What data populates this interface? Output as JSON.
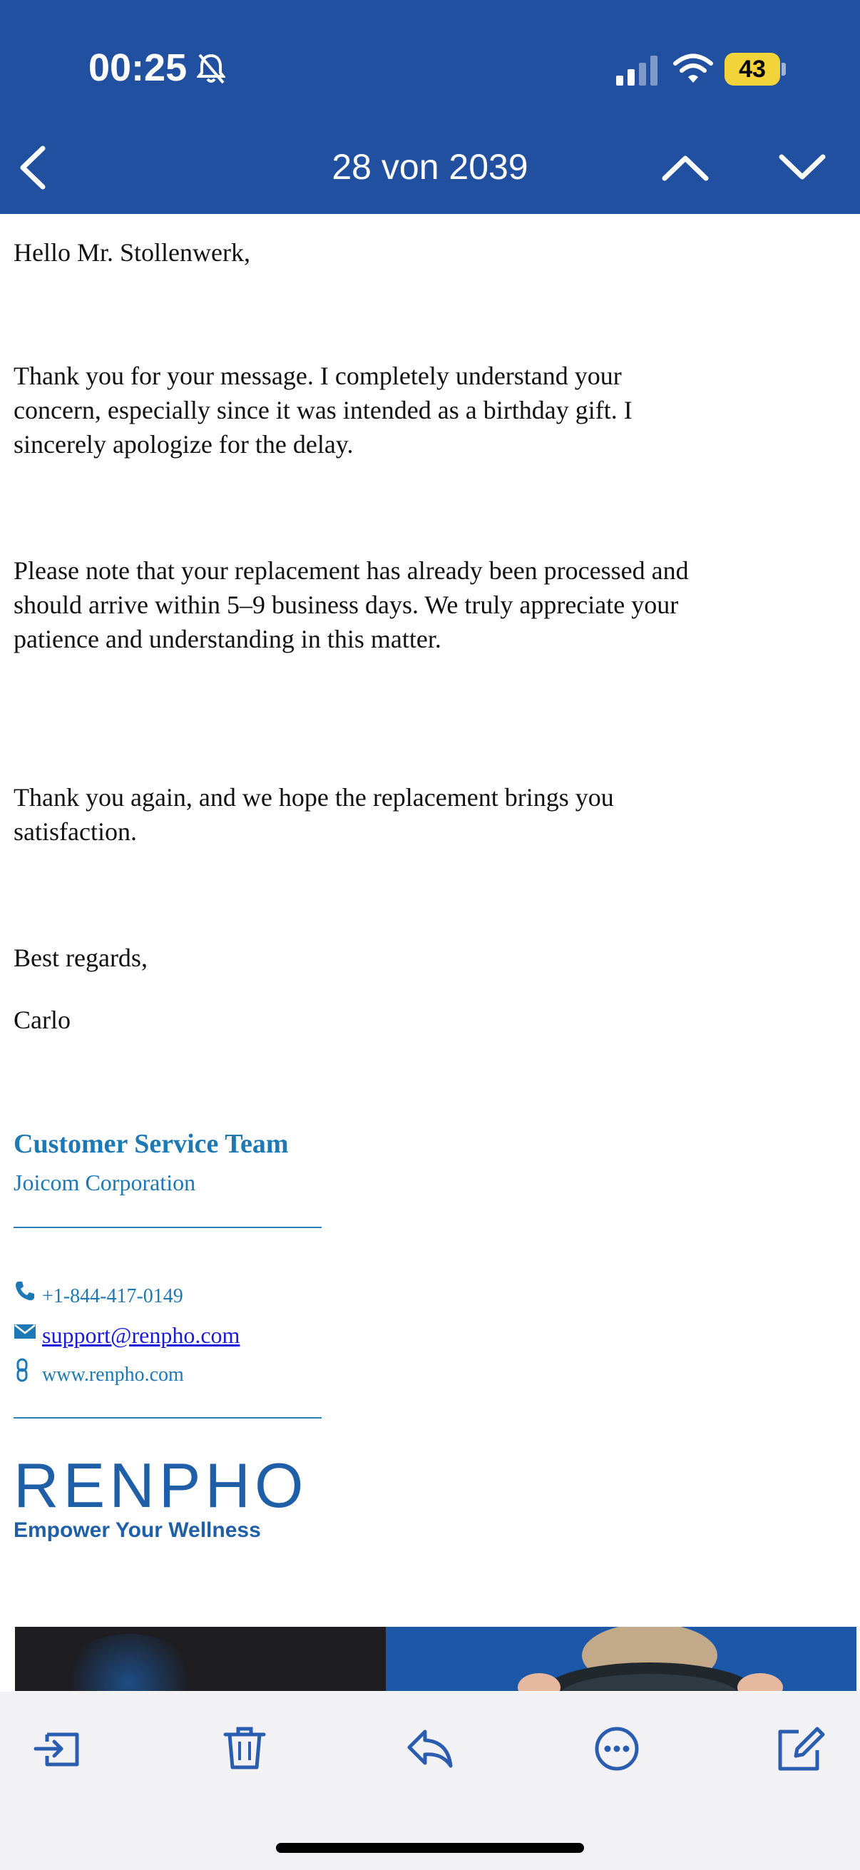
{
  "status_bar": {
    "time": "00:25",
    "battery": "43",
    "icons": [
      "bell-slash-icon",
      "cellular-signal-icon",
      "wifi-icon",
      "battery-icon"
    ]
  },
  "nav": {
    "counter": "28 von 2039",
    "icons": [
      "chevron-left-icon",
      "chevron-up-icon",
      "chevron-down-icon"
    ]
  },
  "email": {
    "greeting": "Hello Mr. Stollenwerk,",
    "paragraph1": "Thank you for your message. I completely understand your concern, especially since it was intended as a birthday gift. I sincerely apologize for the delay.",
    "paragraph2": "Please note that your replacement has already been processed and should arrive within 5–9 business days. We truly appreciate your patience and understanding in this matter.",
    "paragraph3": "Thank you again, and we hope the replacement brings you satisfaction.",
    "closing": "Best regards,",
    "name": "Carlo"
  },
  "signature": {
    "team": "Customer Service Team",
    "company": "Joicom Corporation",
    "phone": "+1-844-417-0149",
    "email": "support@renpho.com",
    "website": "www.renpho.com"
  },
  "logo": {
    "wordmark": "RENPHO",
    "tagline": "Empower Your Wellness"
  },
  "toolbar": {
    "icons": [
      "move-to-folder-icon",
      "trash-icon",
      "reply-icon",
      "more-icon",
      "compose-icon"
    ]
  },
  "colors": {
    "header": "#2150a0",
    "accent": "#1d78b6",
    "toolbar_icon": "#2a5db0",
    "battery": "#f3d33a"
  }
}
